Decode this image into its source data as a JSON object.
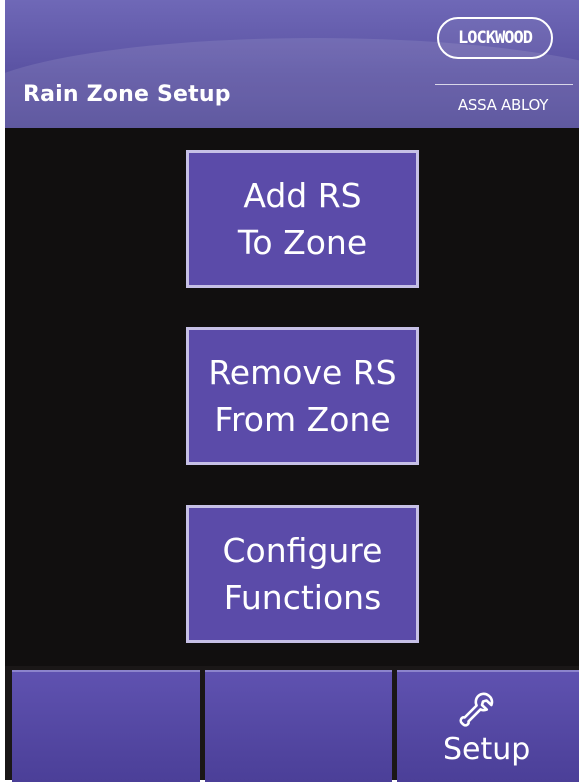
{
  "header": {
    "title": "Rain Zone Setup",
    "brand_logo_text": "LOCKWOOD",
    "brand_sub_text": "ASSA ABLOY"
  },
  "actions": [
    {
      "line1": "Add RS",
      "line2": "To Zone"
    },
    {
      "line1": "Remove RS",
      "line2": "From Zone"
    },
    {
      "line1": "Configure",
      "line2": "Functions"
    }
  ],
  "footer": {
    "tabs": [
      {
        "label": ""
      },
      {
        "label": ""
      },
      {
        "label": "Setup",
        "icon": "wrench-icon"
      }
    ]
  },
  "colors": {
    "header_bg": "#5b53a3",
    "button_bg": "#5b4ba9",
    "button_border": "#c6c0e6",
    "screen_bg": "#110f0f"
  }
}
